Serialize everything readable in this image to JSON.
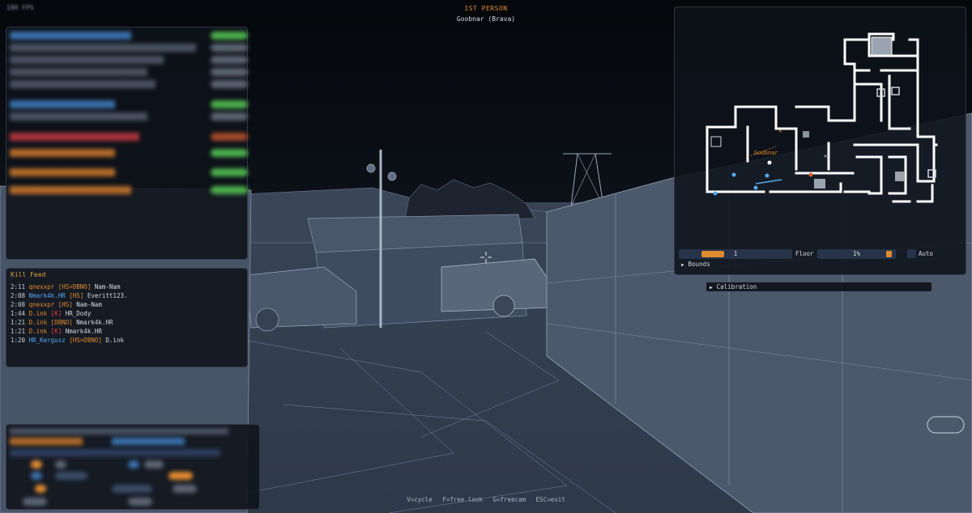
{
  "hud": {
    "fps": "180 FPS",
    "view_mode": "1ST PERSON",
    "spectating": "Goobnar (Brava)"
  },
  "colors": {
    "accent_orange": "#e08a2e",
    "team_blue": "#58a7f0",
    "health_green": "#4cae4c",
    "health_red": "#c0392b",
    "panel_bg": "#0e121a"
  },
  "kill_feed": {
    "title": "Kill Feed",
    "entries": [
      {
        "time": "2:11",
        "killer": "qnexxpr",
        "tag": "[HS>DBNO]",
        "victim": "Nam-Nam"
      },
      {
        "time": "2:08",
        "killer": "Nmark4k.HR",
        "tag": "[HS]",
        "victim": "Everitt123."
      },
      {
        "time": "2:08",
        "killer": "qnexxpr",
        "tag": "[HS]",
        "victim": "Nam-Nam"
      },
      {
        "time": "1:44",
        "killer": "D.ink",
        "tag": "[K]",
        "victim": "HR_Dody"
      },
      {
        "time": "1:21",
        "killer": "D.ink",
        "tag": "[DBNO]",
        "victim": "Nmark4k.HR"
      },
      {
        "time": "1:21",
        "killer": "D.ink",
        "tag": "[K]",
        "victim": "Nmark4k.HR"
      },
      {
        "time": "1:20",
        "killer": "HR_Kergusz",
        "tag": "[HS>DBNO]",
        "victim": "D.ink"
      }
    ]
  },
  "minimap": {
    "player_label": "Goobnar",
    "floor_value": "1",
    "floor_label": "Floor",
    "zoom_value": "1%",
    "auto_label": "Auto",
    "bounds_label": "Bounds"
  },
  "calibration": {
    "label": "Calibration"
  },
  "hints": {
    "cycle": "V=cycle",
    "free_look": "F=free look",
    "freecam": "G=freecam",
    "exit": "ESC=exit"
  }
}
